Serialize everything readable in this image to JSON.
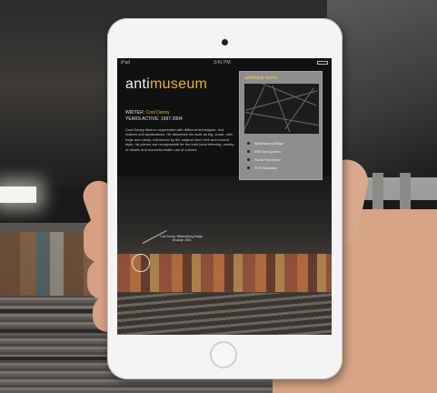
{
  "statusbar": {
    "carrier": "iPad",
    "time": "3:41 PM"
  },
  "logo": {
    "prefix": "anti",
    "suffix": "museum"
  },
  "artist": {
    "writer_label": "WRITER:",
    "writer_name": "Cool Danny",
    "years_label": "YEARS ACTIVE:",
    "years_value": "1997-2004",
    "description": "Cool Danny likes to experiment with different techniques, tool makers and applications. He describes his work as big, smart, with edge and clarity. Influenced by the original New York and current style, his pieces are recognisable for the bold hand lettering, variety of details and monochromatic use of colours."
  },
  "panel": {
    "title": "additional works",
    "legend": [
      {
        "label": "Williamsburg Bridge",
        "year": ""
      },
      {
        "label": "MTA Yard Queens",
        "year": ""
      },
      {
        "label": "Hunts Point Bronx",
        "year": ""
      },
      {
        "label": "FDR Manhattan",
        "year": ""
      }
    ]
  },
  "callout": {
    "text": "Cool Danny. Williamsburg Bridge, Brooklyn 2003"
  },
  "colors": {
    "accent": "#e8b623",
    "panel": "#8e8e8e",
    "screen_bg": "#111111"
  }
}
